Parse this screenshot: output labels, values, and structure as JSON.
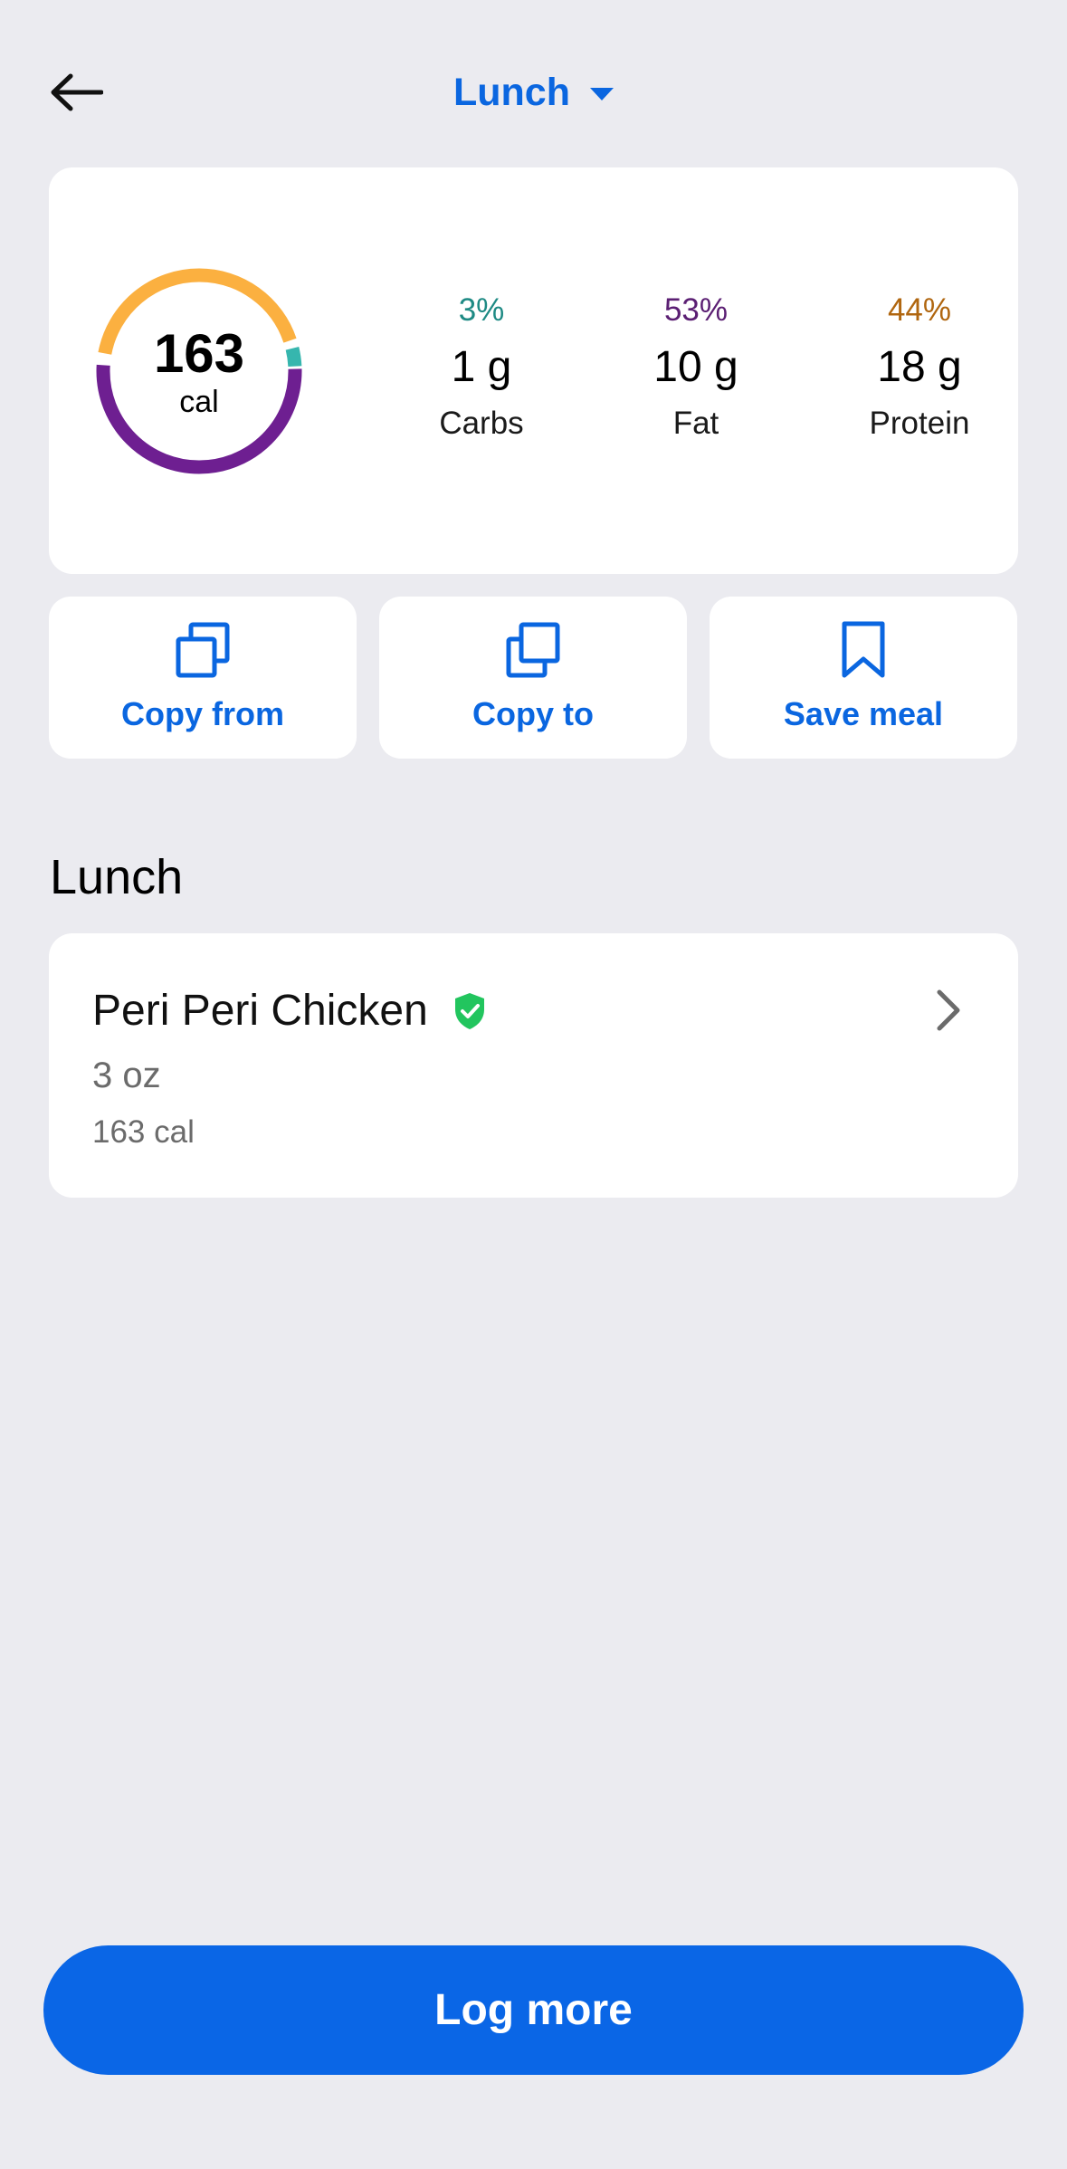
{
  "header": {
    "meal_label": "Lunch"
  },
  "summary": {
    "calories": "163",
    "calories_unit": "cal",
    "macros": [
      {
        "pct": "3%",
        "grams": "1 g",
        "name": "Carbs",
        "color": "#1E8A84"
      },
      {
        "pct": "53%",
        "grams": "10 g",
        "name": "Fat",
        "color": "#5B1F73"
      },
      {
        "pct": "44%",
        "grams": "18 g",
        "name": "Protein",
        "color": "#B0660F"
      }
    ],
    "ring_colors": {
      "carbs": "#36B6AE",
      "fat": "#6E1F91",
      "protein": "#FBB040"
    }
  },
  "actions": {
    "copy_from": "Copy from",
    "copy_to": "Copy to",
    "save_meal": "Save meal"
  },
  "section": {
    "title": "Lunch"
  },
  "food_item": {
    "name": "Peri Peri Chicken",
    "portion": "3 oz",
    "calories": "163 cal",
    "verified_badge_color": "#22C55E"
  },
  "cta": {
    "log_more": "Log more"
  },
  "colors": {
    "accent": "#0A66E0",
    "background": "#EBEBF0"
  }
}
